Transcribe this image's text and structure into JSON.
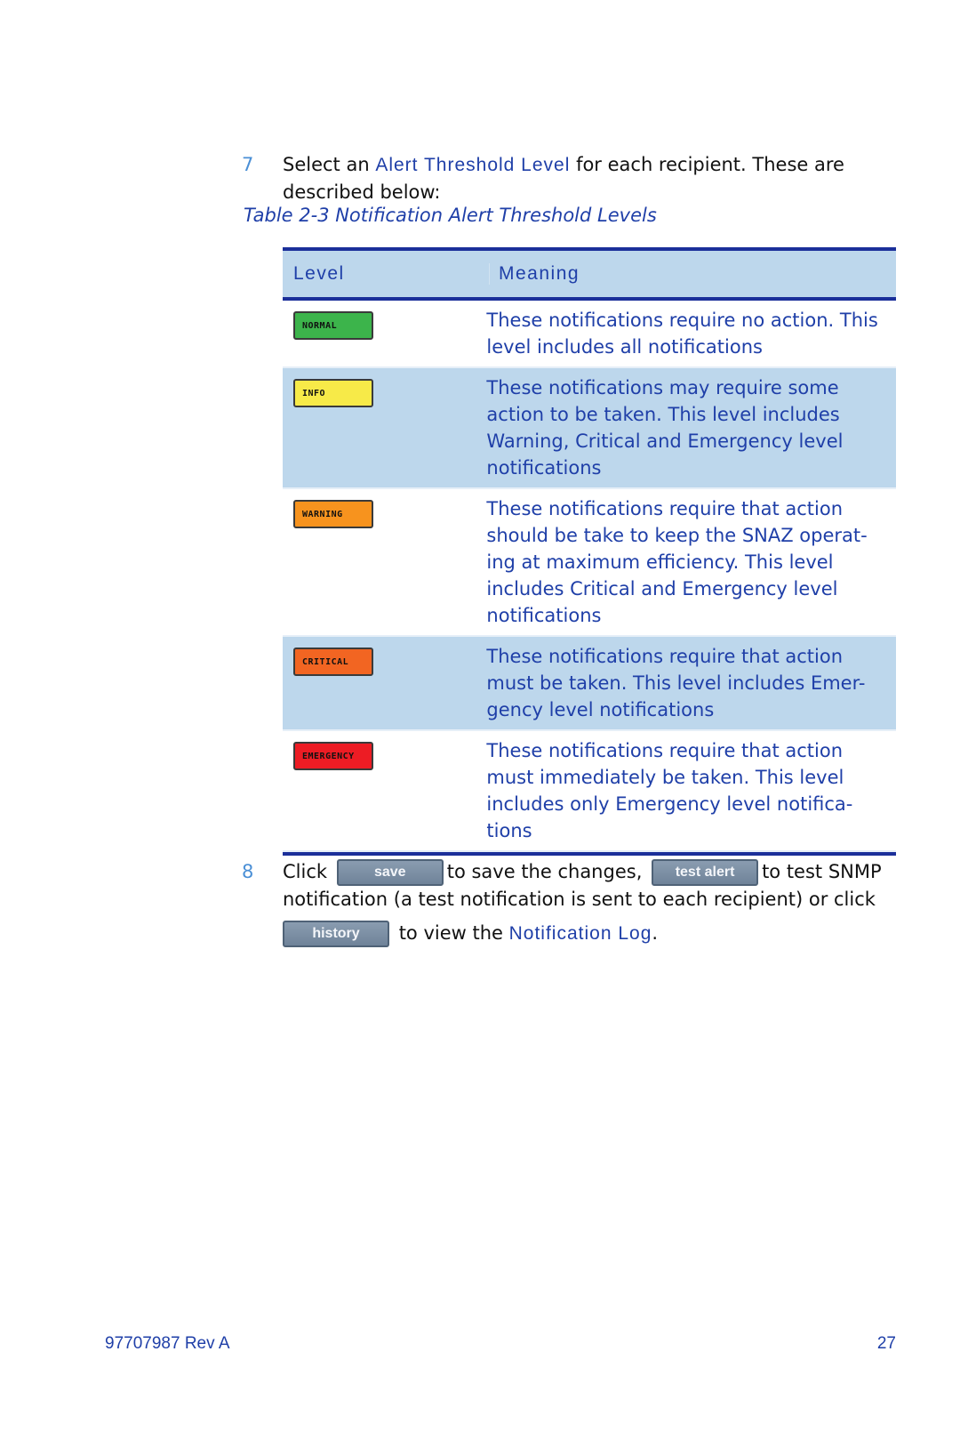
{
  "step7": {
    "number": "7",
    "text_before": "Select an ",
    "term": "Alert Threshold Level",
    "text_after": " for each recipient. These are described below:"
  },
  "caption": "Table 2-3 Notification Alert Threshold Levels",
  "table": {
    "headers": {
      "level": "Level",
      "meaning": "Meaning"
    },
    "rows": [
      {
        "badge": "NORMAL",
        "color": "#3cb44b",
        "meaning": "These notifications require no action. This level includes all notifications"
      },
      {
        "badge": "INFO",
        "color": "#f7ea48",
        "meaning": "These notifications may require some action to be taken. This level includes Warning, Critical and Emergency level notifications"
      },
      {
        "badge": "WARNING",
        "color": "#f7931e",
        "meaning": "These notifications require that action should be take to keep the SNAZ operat-ing at maximum efficiency. This level includes Critical and Emergency level notifications"
      },
      {
        "badge": "CRITICAL",
        "color": "#f26522",
        "meaning": "These notifications require that action must be taken. This level includes Emer-gency level notifications"
      },
      {
        "badge": "EMERGENCY",
        "color": "#ed1c24",
        "meaning": "These notifications require that action must immediately be taken. This level includes only Emergency level notifica-tions"
      }
    ]
  },
  "step8": {
    "number": "8",
    "click": "Click",
    "save_label": "save",
    "after_save": "to save the changes,",
    "test_label": "test alert",
    "after_test": "to test SNMP notification (a test notification is sent to each recipient) or click",
    "history_label": "history",
    "after_history": "to view the ",
    "term": "Notification Log",
    "period": "."
  },
  "footer": {
    "doc_id": "97707987 Rev A",
    "page": "27"
  }
}
